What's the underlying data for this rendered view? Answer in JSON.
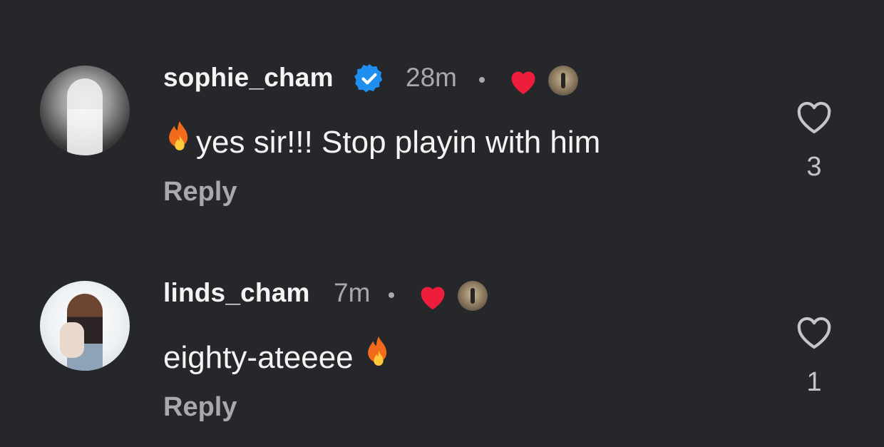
{
  "comments": [
    {
      "username": "sophie_cham",
      "verified": true,
      "time": "28m",
      "text": "yes sir!!! Stop playin with him",
      "reply_label": "Reply",
      "like_count": "3",
      "icons": [
        "verified-badge-icon",
        "heart-filled-icon",
        "fire-emoji-icon",
        "heart-outline-icon"
      ]
    },
    {
      "username": "linds_cham",
      "verified": false,
      "time": "7m",
      "text": "eighty-ateeee",
      "reply_label": "Reply",
      "like_count": "1",
      "icons": [
        "heart-filled-icon",
        "fire-emoji-icon",
        "heart-outline-icon"
      ]
    }
  ],
  "colors": {
    "background": "#26272b",
    "primary_text": "#f4f4f4",
    "secondary_text": "#a8a9ad",
    "verified_blue": "#1f8ef1",
    "heart_red": "#ee1d3c"
  }
}
